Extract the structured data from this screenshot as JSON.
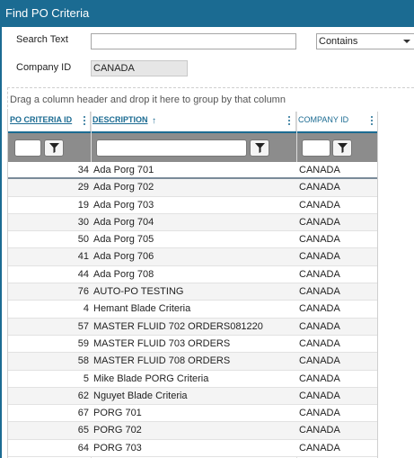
{
  "title": "Find PO Criteria",
  "search": {
    "label": "Search Text",
    "value": "",
    "mode": "Contains"
  },
  "company": {
    "label": "Company ID",
    "value": "CANADA"
  },
  "group_panel_text": "Drag a column header and drop it here to group by that column",
  "columns": {
    "id": "PO CRITERIA ID",
    "description": "DESCRIPTION",
    "company": "COMPANY ID"
  },
  "rows": [
    {
      "id": "34",
      "description": "Ada Porg 701",
      "company": "CANADA"
    },
    {
      "id": "29",
      "description": "Ada Porg 702",
      "company": "CANADA"
    },
    {
      "id": "19",
      "description": "Ada Porg 703",
      "company": "CANADA"
    },
    {
      "id": "30",
      "description": "Ada Porg 704",
      "company": "CANADA"
    },
    {
      "id": "50",
      "description": "Ada Porg 705",
      "company": "CANADA"
    },
    {
      "id": "41",
      "description": "Ada Porg 706",
      "company": "CANADA"
    },
    {
      "id": "44",
      "description": "Ada Porg 708",
      "company": "CANADA"
    },
    {
      "id": "76",
      "description": "AUTO-PO TESTING",
      "company": "CANADA"
    },
    {
      "id": "4",
      "description": "Hemant Blade Criteria",
      "company": "CANADA"
    },
    {
      "id": "57",
      "description": "MASTER FLUID 702 ORDERS081220",
      "company": "CANADA"
    },
    {
      "id": "59",
      "description": "MASTER FLUID 703 ORDERS",
      "company": "CANADA"
    },
    {
      "id": "58",
      "description": "MASTER FLUID 708 ORDERS",
      "company": "CANADA"
    },
    {
      "id": "5",
      "description": "Mike Blade PORG Criteria",
      "company": "CANADA"
    },
    {
      "id": "62",
      "description": "Nguyet Blade Criteria",
      "company": "CANADA"
    },
    {
      "id": "67",
      "description": "PORG 701",
      "company": "CANADA"
    },
    {
      "id": "65",
      "description": "PORG 702",
      "company": "CANADA"
    },
    {
      "id": "64",
      "description": "PORG 703",
      "company": "CANADA"
    }
  ]
}
